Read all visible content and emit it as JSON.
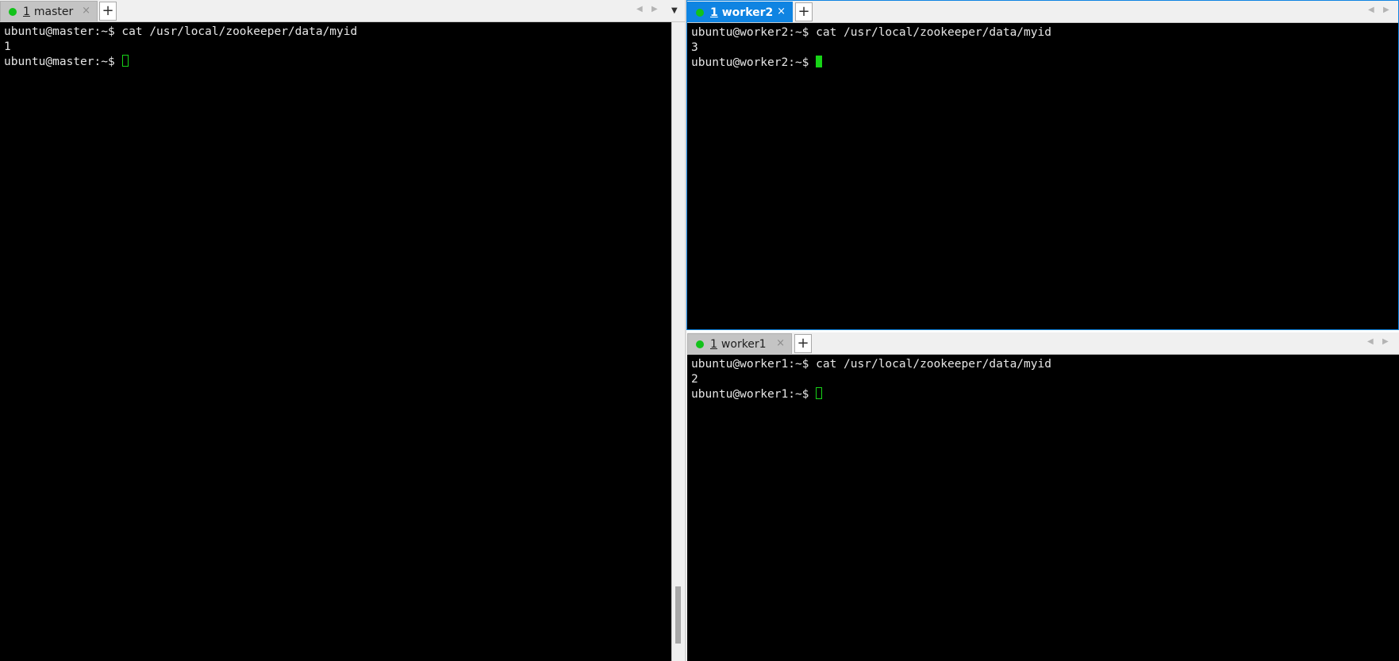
{
  "colors": {
    "terminal_bg": "#000000",
    "terminal_text": "#e6e6e6",
    "active_tab": "#0f84e2",
    "status_dot": "#12c21a",
    "cursor": "#17d417"
  },
  "panes": {
    "master": {
      "tab": {
        "number": "1",
        "title": "master",
        "close": "×",
        "add": "+"
      },
      "nav": {
        "prev": "◀",
        "next": "▶",
        "menu": "▼"
      },
      "lines": [
        "ubuntu@master:~$ cat /usr/local/zookeeper/data/myid",
        "1",
        "ubuntu@master:~$"
      ]
    },
    "worker2": {
      "tab": {
        "number": "1",
        "title": "worker2",
        "close": "×",
        "add": "+"
      },
      "nav": {
        "prev": "◀",
        "next": "▶"
      },
      "lines": [
        "ubuntu@worker2:~$ cat /usr/local/zookeeper/data/myid",
        "3",
        "ubuntu@worker2:~$"
      ]
    },
    "worker1": {
      "tab": {
        "number": "1",
        "title": "worker1",
        "close": "×",
        "add": "+"
      },
      "nav": {
        "prev": "◀",
        "next": "▶"
      },
      "lines": [
        "ubuntu@worker1:~$ cat /usr/local/zookeeper/data/myid",
        "2",
        "ubuntu@worker1:~$"
      ]
    }
  },
  "icons": {
    "status": "status-dot-icon",
    "close": "close-icon",
    "add": "plus-icon",
    "prev": "chevron-left-icon",
    "next": "chevron-right-icon",
    "menu": "chevron-down-icon"
  }
}
